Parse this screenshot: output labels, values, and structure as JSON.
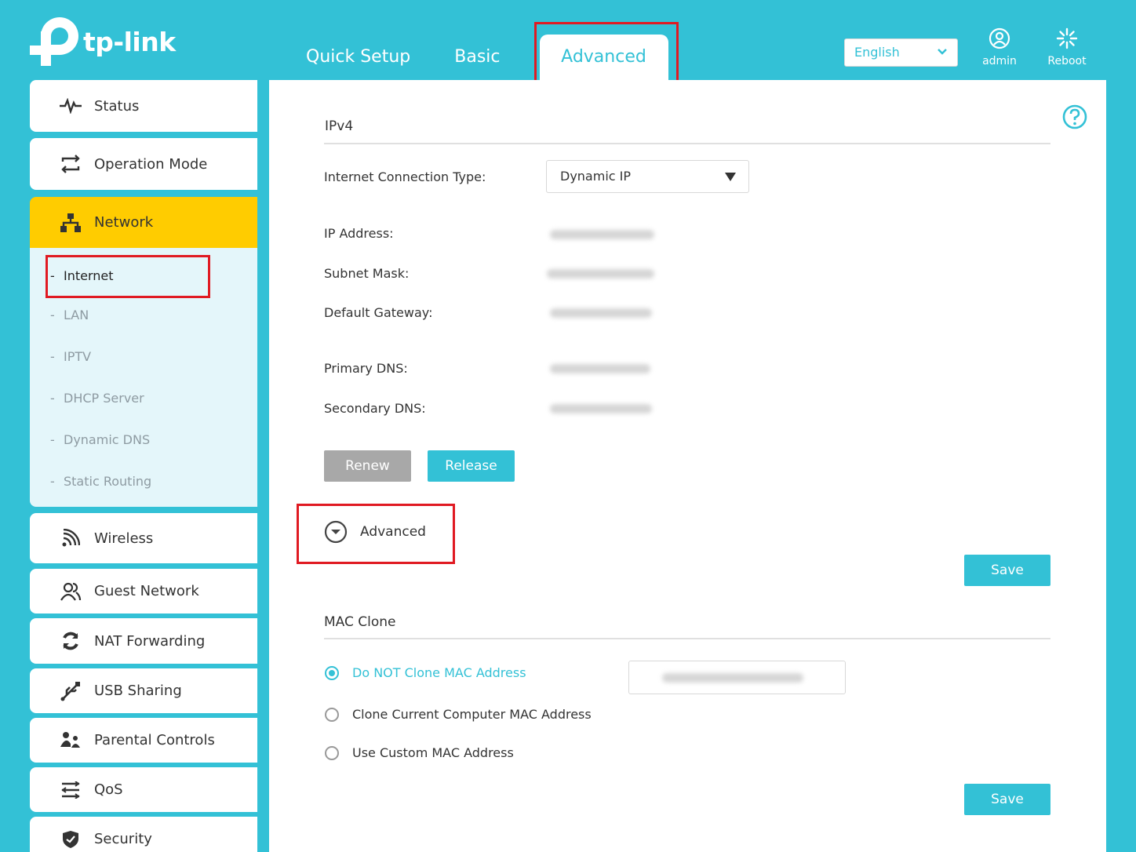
{
  "brand": {
    "name": "tp-link",
    "accent": "#33c1d6",
    "highlight": "#ffcc00",
    "annotation": "#e01a22"
  },
  "header": {
    "tabs": [
      {
        "label": "Quick Setup",
        "active": false
      },
      {
        "label": "Basic",
        "active": false
      },
      {
        "label": "Advanced",
        "active": true
      }
    ],
    "language": "English",
    "admin_label": "admin",
    "reboot_label": "Reboot"
  },
  "sidebar": {
    "items": [
      {
        "label": "Status",
        "icon": "pulse-icon"
      },
      {
        "label": "Operation Mode",
        "icon": "swap-arrows-icon"
      },
      {
        "label": "Network",
        "icon": "network-topology-icon",
        "active": true
      },
      {
        "label": "Wireless",
        "icon": "wifi-icon"
      },
      {
        "label": "Guest Network",
        "icon": "guests-icon"
      },
      {
        "label": "NAT Forwarding",
        "icon": "refresh-circle-icon"
      },
      {
        "label": "USB Sharing",
        "icon": "usb-icon"
      },
      {
        "label": "Parental Controls",
        "icon": "family-icon"
      },
      {
        "label": "QoS",
        "icon": "sliders-icon"
      },
      {
        "label": "Security",
        "icon": "shield-icon"
      }
    ],
    "network_sub": [
      {
        "label": "Internet",
        "active": true
      },
      {
        "label": "LAN"
      },
      {
        "label": "IPTV"
      },
      {
        "label": "DHCP Server"
      },
      {
        "label": "Dynamic DNS"
      },
      {
        "label": "Static Routing"
      }
    ]
  },
  "ipv4": {
    "title": "IPv4",
    "connection_type_label": "Internet Connection Type:",
    "connection_type_value": "Dynamic IP",
    "ip_label": "IP Address:",
    "subnet_label": "Subnet Mask:",
    "gateway_label": "Default Gateway:",
    "primary_dns_label": "Primary DNS:",
    "secondary_dns_label": "Secondary DNS:",
    "renew_label": "Renew",
    "release_label": "Release",
    "advanced_label": "Advanced",
    "save_label": "Save"
  },
  "mac_clone": {
    "title": "MAC Clone",
    "options": [
      {
        "label": "Do NOT Clone MAC Address",
        "selected": true
      },
      {
        "label": "Clone Current Computer MAC Address",
        "selected": false
      },
      {
        "label": "Use Custom MAC Address",
        "selected": false
      }
    ],
    "save_label": "Save"
  }
}
